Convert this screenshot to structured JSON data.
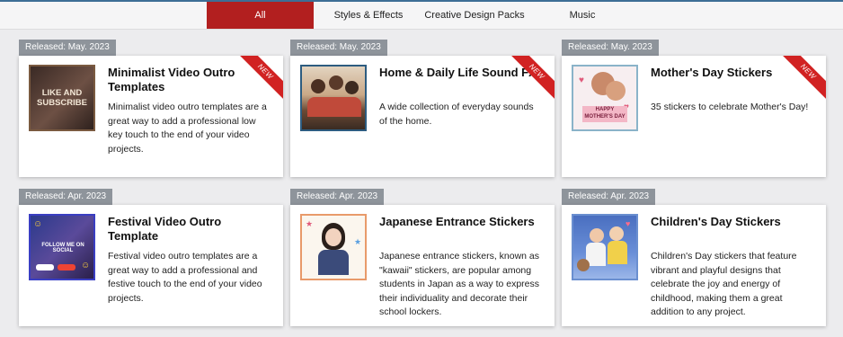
{
  "tabs": [
    {
      "label": "All",
      "active": true
    },
    {
      "label": "Styles & Effects",
      "active": false
    },
    {
      "label": "Creative Design Packs",
      "active": false
    },
    {
      "label": "Music",
      "active": false
    }
  ],
  "ribbon_label": "NEW",
  "cards": [
    {
      "released": "Released: May. 2023",
      "title": "Minimalist Video Outro Templates",
      "desc": "Minimalist video outro templates are a great way to add a professional low key touch to the end of your video projects.",
      "new": true,
      "thumb_text": "LIKE AND SUBSCRIBE"
    },
    {
      "released": "Released: May. 2023",
      "title": "Home & Daily Life Sound FX",
      "desc": "A wide collection of everyday sounds of the home.",
      "new": true
    },
    {
      "released": "Released: May. 2023",
      "title": "Mother's Day Stickers",
      "desc": "35 stickers to celebrate Mother's Day!",
      "new": true,
      "thumb_text": "HAPPY MOTHER'S DAY"
    },
    {
      "released": "Released: Apr. 2023",
      "title": "Festival Video Outro Template",
      "desc": "Festival video outro templates are a great way to add a professional and festive touch to the end of your video projects.",
      "new": false,
      "thumb_text": "FOLLOW ME ON SOCIAL"
    },
    {
      "released": "Released: Apr. 2023",
      "title": "Japanese Entrance Stickers",
      "desc": "Japanese entrance stickers, known as \"kawaii\" stickers, are popular among students in Japan as a way to express their individuality and decorate their school lockers.",
      "new": false
    },
    {
      "released": "Released: Apr. 2023",
      "title": "Children's Day Stickers",
      "desc": "Children's Day stickers that feature vibrant and playful designs that celebrate the joy and energy of childhood, making them a great addition to any project.",
      "new": false
    }
  ],
  "colors": {
    "active_tab": "#b21f1f",
    "badge": "#8e949b",
    "ribbon": "#d12222"
  }
}
